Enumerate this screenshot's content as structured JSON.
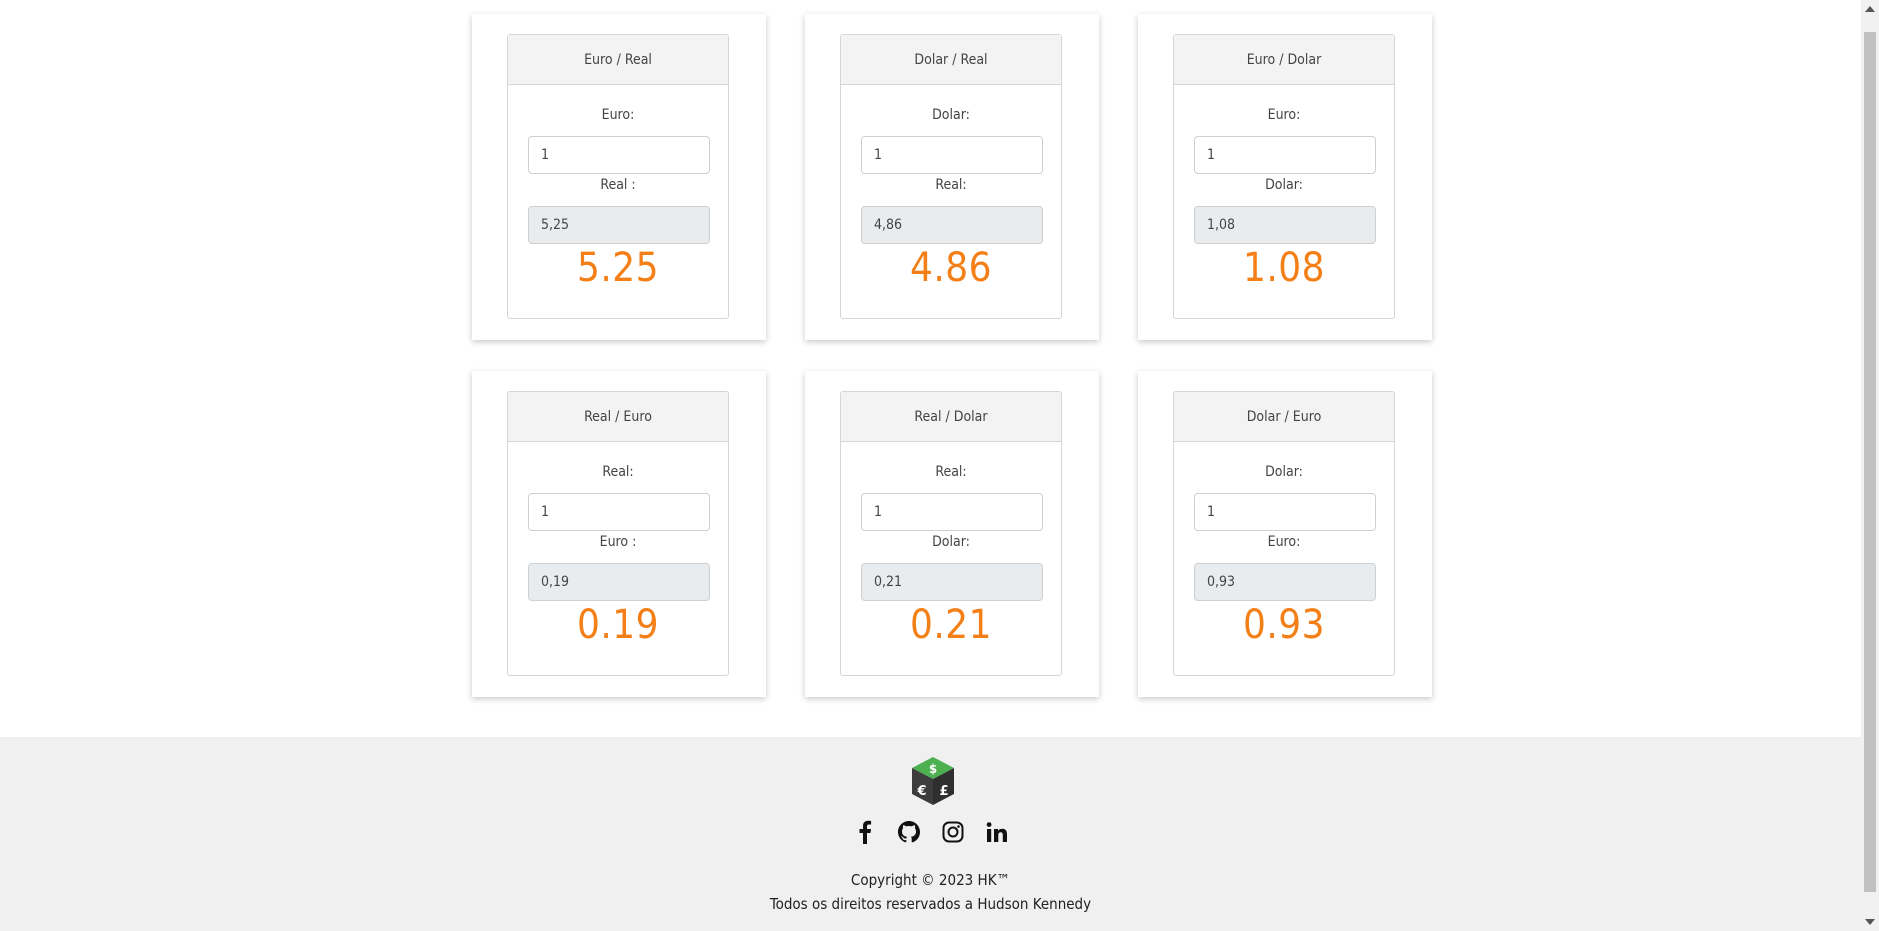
{
  "cards": [
    {
      "title": "Euro / Real",
      "from_label": "Euro:",
      "from_value": "1",
      "to_label": "Real :",
      "to_value": "5,25",
      "result": "5.25"
    },
    {
      "title": "Dolar / Real",
      "from_label": "Dolar:",
      "from_value": "1",
      "to_label": "Real:",
      "to_value": "4,86",
      "result": "4.86"
    },
    {
      "title": "Euro / Dolar",
      "from_label": "Euro:",
      "from_value": "1",
      "to_label": "Dolar:",
      "to_value": "1,08",
      "result": "1.08"
    },
    {
      "title": "Real / Euro",
      "from_label": "Real:",
      "from_value": "1",
      "to_label": "Euro :",
      "to_value": "0,19",
      "result": "0.19"
    },
    {
      "title": "Real / Dolar",
      "from_label": "Real:",
      "from_value": "1",
      "to_label": "Dolar:",
      "to_value": "0,21",
      "result": "0.21"
    },
    {
      "title": "Dolar / Euro",
      "from_label": "Dolar:",
      "from_value": "1",
      "to_label": "Euro:",
      "to_value": "0,93",
      "result": "0.93"
    }
  ],
  "footer": {
    "logo_icon": "currency-cube-logo",
    "logo_letters": [
      "$",
      "€",
      "£"
    ],
    "social_icons": [
      "facebook-icon",
      "github-icon",
      "instagram-icon",
      "linkedin-icon"
    ],
    "copyright": "Copyright © 2023 HK™",
    "rights": "Todos os direitos reservados a Hudson Kennedy"
  },
  "colors": {
    "accent": "#f57f17",
    "footer_bg": "#f0f0f0",
    "logo_green": "#4caf50",
    "logo_dark": "#3c3c3c"
  }
}
